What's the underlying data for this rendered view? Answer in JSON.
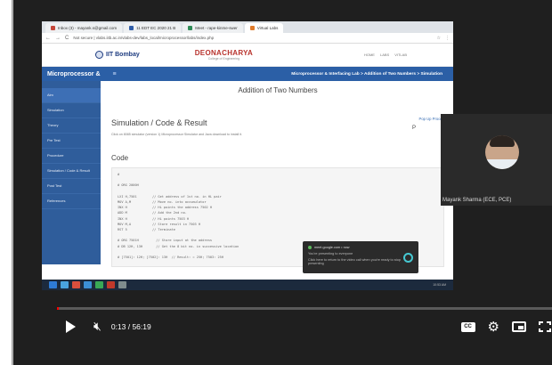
{
  "browser": {
    "tabs": [
      {
        "label": "Inbox (3) - mayank.s@gmail.com",
        "color": "#c5463a"
      },
      {
        "label": "11 EDT EC 2020 21 B",
        "color": "#2f5ca8"
      },
      {
        "label": "Meet - rape-kinme-swer",
        "color": "#2e8b57"
      },
      {
        "label": "Virtual Labs",
        "color": "#e07b2a"
      }
    ],
    "url": "Not secure | vlabs.iitb.ac.in/vlabs-dev/labs_local/microprocessor/labs/index.php",
    "controls": [
      "←",
      "→",
      "C"
    ],
    "right_icons": [
      "☆",
      "⋮"
    ]
  },
  "site": {
    "logo_text": "IIT Bombay",
    "center_title": "DEONACHARYA",
    "center_subtitle": "College of Engineering",
    "nav": [
      "HOME",
      "LABS",
      "VITLAB"
    ]
  },
  "navbar": {
    "brand": "Microprocessor &",
    "menu_glyph": "≡",
    "breadcrumb": "Microprocessor & Interfacing Lab > Addition of Two Numbers > Simulation"
  },
  "sidebar": {
    "items": [
      {
        "label": "Aim",
        "active": true
      },
      {
        "label": "Simulation",
        "active": false
      },
      {
        "label": "Theory",
        "active": false
      },
      {
        "label": "Pre Test",
        "active": false
      },
      {
        "label": "Procedure",
        "active": false
      },
      {
        "label": "Simulation / Code & Result",
        "active": false
      },
      {
        "label": "Post Test",
        "active": false
      },
      {
        "label": "References",
        "active": false
      }
    ]
  },
  "content": {
    "title": "Addition of Two Numbers",
    "popup_link": "Pop Up Procedure",
    "p_letter": "P",
    "sim_heading": "Simulation / Code & Result",
    "sim_desc": "Click on 8085 simulator (version 1) Microprocessor Simulator and Java download to install it.",
    "code_heading": "Code",
    "code": "#\n\n# ORG 2000H\n\nLXI H,7501        // Get address of 1st no. in HL pair\nMOV A,M           // Move no. into accumulator\nINX H             // HL points the address 7502 H\nADD M             // Add the 2nd no.\nINX H             // HL points 7503 H\nMOV M,A           // Store result in 7503 H\nRST 5             // Terminate\n\n# ORG 7501H         // Store input at the address\n# DB 12H, 13H       // Get the 8 bit no. in successive location\n\n# [7501]: 12H; [7502]: 13H  // Result: = 25H; 7503: 25H"
  },
  "toast": {
    "line1": "meet.google.com • now",
    "line2": "You're presenting to everyone",
    "line3": "Click here to return to the video call when you're ready to stop presenting"
  },
  "taskbar": {
    "icons": [
      "#2e7bd6",
      "#4aa3df",
      "#d94f3d",
      "#3c8fd6",
      "#3aa856",
      "#c0392b",
      "#7f8c8d"
    ],
    "time": "10:53 AM"
  },
  "participant": {
    "name": "Mayank Sharma (ECE, PCE)"
  },
  "video": {
    "time_display": "0:13 / 56:19",
    "progress_fraction": 0.004,
    "cc_label": "CC",
    "accent_color": "#ff0000"
  }
}
